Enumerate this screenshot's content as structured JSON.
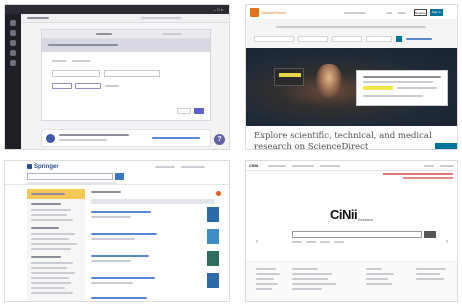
{
  "tiles": {
    "teams": {
      "window_title": "",
      "help_label": "?",
      "colors": {
        "accent": "#5b5fc7",
        "rail": "#1f1f26"
      }
    },
    "sciencedirect": {
      "brand": "ScienceDirect",
      "register_label": "Register",
      "sign_in_label": "Sign in",
      "tagline": "Explore scientific, technical, and medical research on ScienceDirect",
      "colors": {
        "accent": "#007398",
        "logo": "#e9711c"
      }
    },
    "springer": {
      "brand": "Springer",
      "colors": {
        "accent": "#3b78c4",
        "badge": "#f6c85a"
      }
    },
    "cinii": {
      "header_brand": "CiNii",
      "logo_text": "CiNii",
      "logo_subtext": "Research",
      "left_arrow": "‹",
      "right_arrow": "›",
      "colors": {
        "notice": "#d23a3a"
      }
    }
  }
}
